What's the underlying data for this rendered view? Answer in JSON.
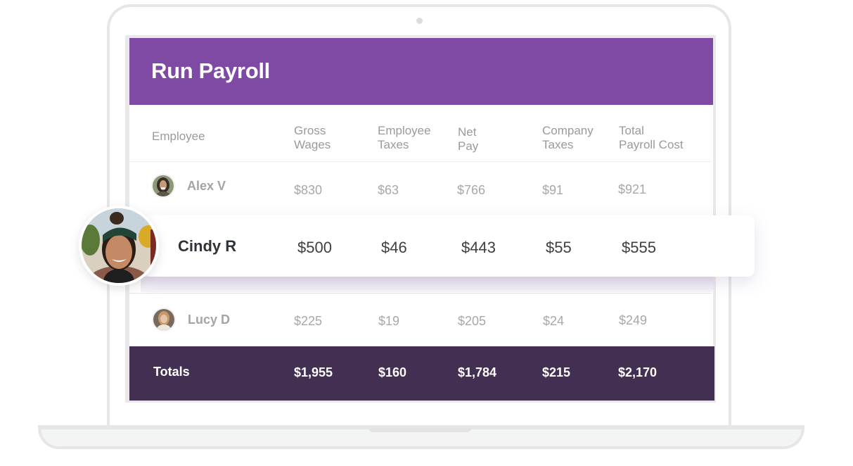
{
  "app": {
    "title": "Run Payroll",
    "colors": {
      "header": "#7f4aa4",
      "totals_bar": "#432f52"
    }
  },
  "table": {
    "columns": [
      {
        "line1": "",
        "line2": "Employee"
      },
      {
        "line1": "Gross",
        "line2": "Wages"
      },
      {
        "line1": "Employee",
        "line2": "Taxes"
      },
      {
        "line1": "Net",
        "line2": "Pay"
      },
      {
        "line1": "Company",
        "line2": "Taxes"
      },
      {
        "line1": "Total",
        "line2": "Payroll Cost"
      }
    ],
    "rows": [
      {
        "name": "Alex V",
        "avatar": "avatar-photo",
        "gross": "$830",
        "emp_tax": "$63",
        "net": "$766",
        "co_tax": "$91",
        "total": "$921"
      },
      {
        "name": "Cindy R",
        "avatar": "avatar-photo",
        "gross": "$500",
        "emp_tax": "$46",
        "net": "$443",
        "co_tax": "$55",
        "total": "$555",
        "highlighted": true
      },
      {
        "name": "Lucy D",
        "avatar": "avatar-photo",
        "gross": "$225",
        "emp_tax": "$19",
        "net": "$205",
        "co_tax": "$24",
        "total": "$249"
      }
    ],
    "totals": {
      "label": "Totals",
      "gross": "$1,955",
      "emp_tax": "$160",
      "net": "$1,784",
      "co_tax": "$215",
      "total": "$2,170"
    }
  }
}
